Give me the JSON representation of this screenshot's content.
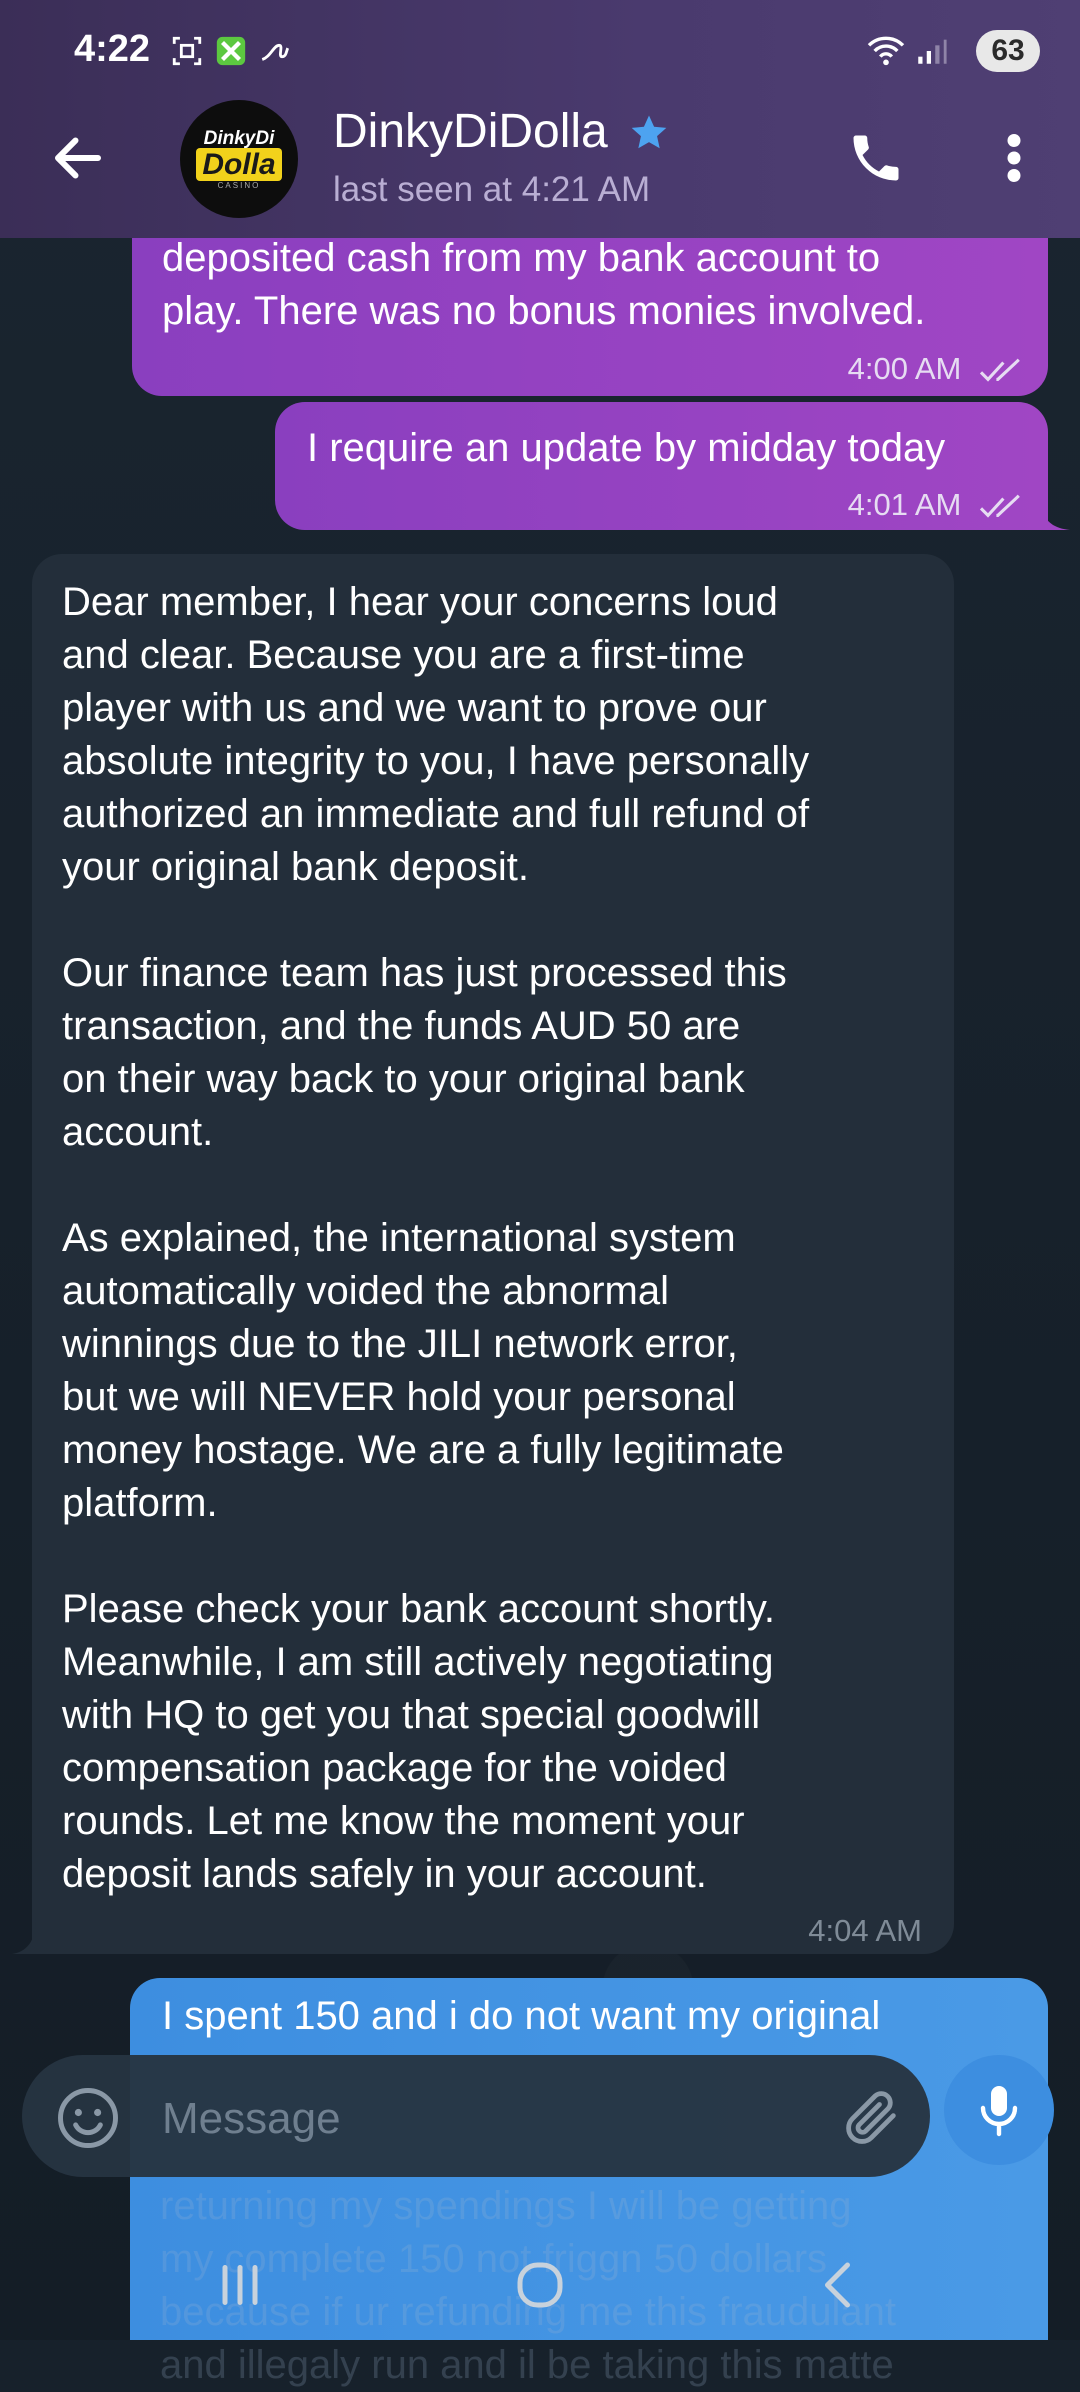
{
  "status_bar": {
    "time": "4:22",
    "battery": "63"
  },
  "header": {
    "avatar": {
      "line1": "DinkyDi",
      "line2": "Dolla",
      "line3": "CASINO"
    },
    "contact_name": "DinkyDiDolla",
    "last_seen": "last seen at 4:21 AM"
  },
  "messages": [
    {
      "direction": "out",
      "lines": [
        "deposited cash from my bank account to",
        "play. There was no bonus monies involved."
      ],
      "time": "4:00 AM"
    },
    {
      "direction": "out",
      "lines": [
        "I require an update by midday today"
      ],
      "time": "4:01 AM"
    },
    {
      "direction": "in",
      "lines": [
        "Dear member, I hear your concerns loud",
        "and clear. Because you are a first-time",
        "player with us and we want to prove our",
        "absolute integrity to you, I have personally",
        "authorized an immediate and full refund of",
        "your original bank deposit.",
        "",
        "Our finance team has just processed this",
        "transaction, and the funds AUD 50 are",
        "on their way back to your original bank",
        "account.",
        "",
        "As explained, the international system",
        "automatically voided the abnormal",
        "winnings due to the JILI network error,",
        "but we will NEVER hold your personal",
        "money hostage. We are a fully legitimate",
        "platform.",
        "",
        "Please check your bank account shortly.",
        "Meanwhile, I am still actively negotiating",
        "with HQ to get you that special goodwill",
        "compensation package for the voided",
        "rounds. Let me know the moment your",
        "deposit lands safely in your account."
      ],
      "time": "4:04 AM"
    },
    {
      "direction": "out",
      "lines": [
        "I spent 150 and i do not want my original"
      ],
      "time": ""
    }
  ],
  "hidden_text": [
    "returning my spendings I will be getting",
    "my complete 150 not friggn 50 dollars",
    "because if ur refunding me this fraudulant",
    "and illegaly run and il be taking this matte"
  ],
  "input": {
    "placeholder": "Message"
  },
  "colors": {
    "accent": "#3d8ee0",
    "outgoing": "#9a44c2",
    "incoming": "#232e3a",
    "header": "#4a3a6e"
  }
}
